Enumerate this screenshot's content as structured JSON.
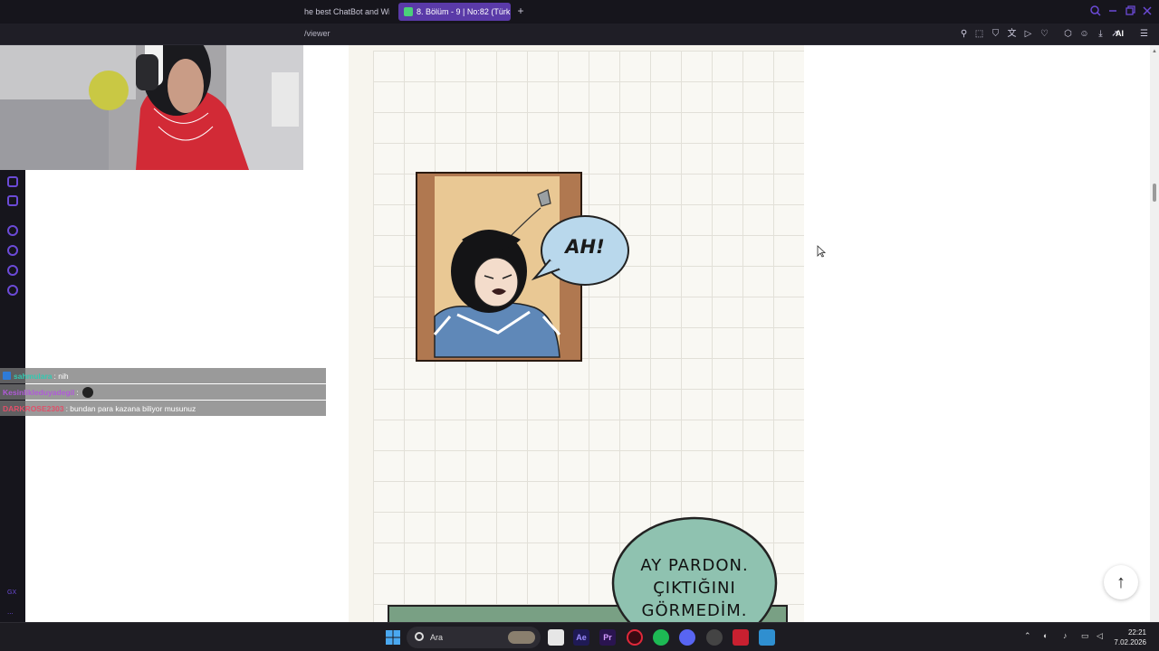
{
  "browser": {
    "tabs": [
      {
        "title": "he best ChatBot and Wid"
      },
      {
        "title": "8. Bölüm - 9 | No:82 (Türk"
      }
    ],
    "url": "/viewer",
    "ai_label": "AI"
  },
  "comic": {
    "speech_1": "AH!",
    "speech_2_lines": [
      "AY PARDON.",
      "ÇIKTIĞINI",
      "GÖRMEDİM."
    ]
  },
  "chat": {
    "messages": [
      {
        "user": "sahmulara",
        "text": ": nih",
        "user_color": "#33c9b0"
      },
      {
        "user": "Kesinlikleduyadegil",
        "text": ":",
        "user_color": "#b05ad8"
      },
      {
        "user": "DARKROSE2303",
        "text": ": bundan para kazana biliyor musunuz",
        "user_color": "#e0506a"
      }
    ]
  },
  "taskbar": {
    "search_label": "Ara",
    "clock_time": "22:21",
    "clock_date": "7.02.2026"
  },
  "sidebar": {
    "gx_label": "GX",
    "more_label": "..."
  },
  "colors": {
    "accent": "#6b4ad6",
    "active_tab": "#5a3aa8"
  }
}
